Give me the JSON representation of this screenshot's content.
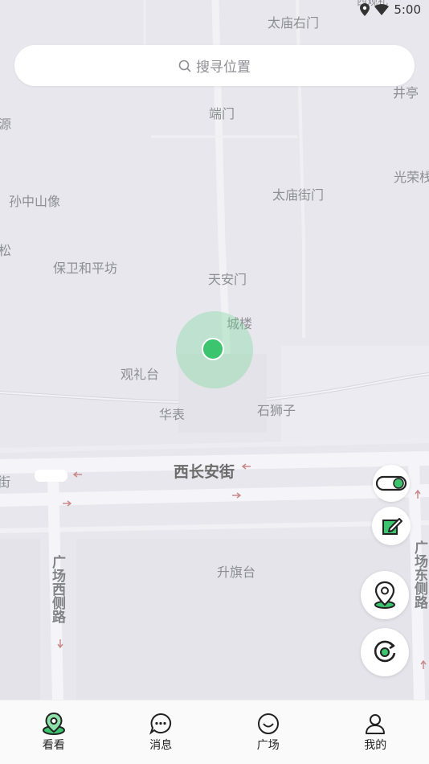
{
  "status_bar": {
    "time": "5:00"
  },
  "search": {
    "placeholder": "搜寻位置"
  },
  "map": {
    "labels": {
      "taimiao_right_gate": "太庙右门",
      "well_pavilion": "井亭",
      "duanmen": "端门",
      "yuan": "源",
      "guangrong": "光荣栈",
      "sun_zhongshan": "孙中山像",
      "taimiao_street_gate": "太庙街门",
      "song": "松",
      "baowei_peace": "保卫和平坊",
      "tiananmen": "天安门",
      "chenglou": "城楼",
      "guanlitai": "观礼台",
      "huabiao": "华表",
      "shishizi": "石狮子",
      "xichangan": "西长安街",
      "jie": "街",
      "guangchang_west": "广场西侧路",
      "shengqitai": "升旗台",
      "guangchang_east": "广场东侧路",
      "top_cut": "西观礼"
    }
  },
  "tabs": [
    {
      "label": "看看",
      "icon": "map-pin-icon",
      "active": true
    },
    {
      "label": "消息",
      "icon": "chat-bubble-icon",
      "active": false
    },
    {
      "label": "广场",
      "icon": "smile-circle-icon",
      "active": false
    },
    {
      "label": "我的",
      "icon": "user-icon",
      "active": false
    }
  ],
  "colors": {
    "accent": "#3cc46e",
    "map_bg": "#e8e7ee",
    "road": "#f4f4f8"
  }
}
